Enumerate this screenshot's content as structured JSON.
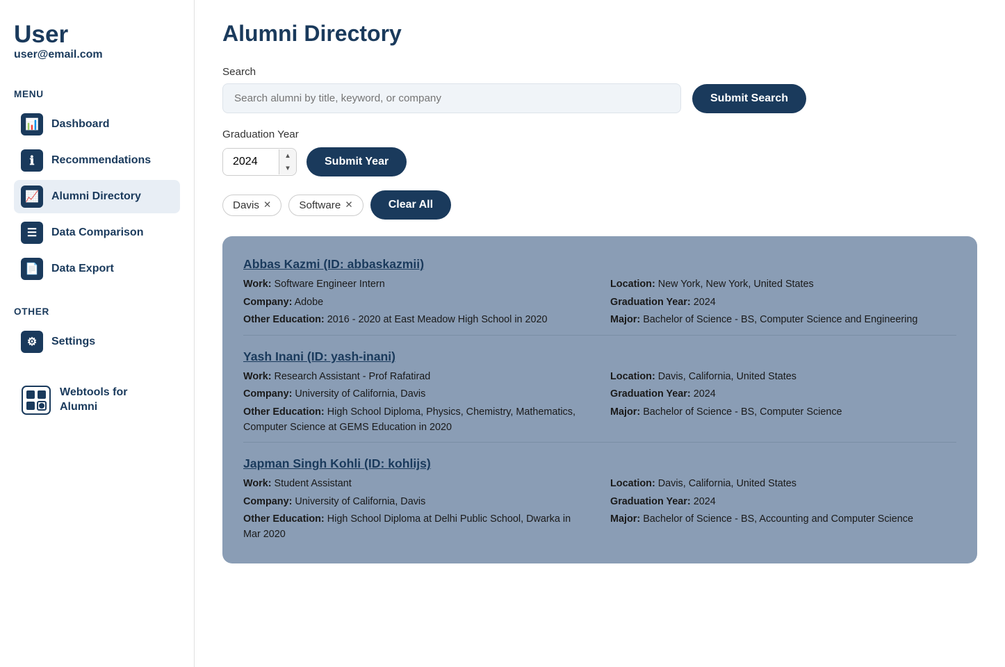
{
  "sidebar": {
    "user_name": "User",
    "user_email": "user@email.com",
    "menu_label": "MENU",
    "other_label": "OTHER",
    "menu_items": [
      {
        "id": "dashboard",
        "label": "Dashboard",
        "icon": "📊"
      },
      {
        "id": "recommendations",
        "label": "Recommendations",
        "icon": "ℹ"
      },
      {
        "id": "alumni-directory",
        "label": "Alumni Directory",
        "icon": "📈",
        "active": true
      },
      {
        "id": "data-comparison",
        "label": "Data Comparison",
        "icon": "☰"
      },
      {
        "id": "data-export",
        "label": "Data Export",
        "icon": "📄"
      }
    ],
    "other_items": [
      {
        "id": "settings",
        "label": "Settings",
        "icon": "⚙"
      }
    ],
    "webtools_label": "Webtools for\nAlumni"
  },
  "main": {
    "page_title": "Alumni Directory",
    "search": {
      "label": "Search",
      "placeholder": "Search alumni by title, keyword, or company",
      "submit_label": "Submit Search"
    },
    "grad_year": {
      "label": "Graduation Year",
      "value": "2024",
      "submit_label": "Submit Year"
    },
    "filters": [
      {
        "id": "davis",
        "label": "Davis"
      },
      {
        "id": "software",
        "label": "Software"
      }
    ],
    "clear_all_label": "Clear All",
    "alumni": [
      {
        "name": "Abbas Kazmi (ID: abbaskazmii)",
        "work": "Software Engineer Intern",
        "company": "Adobe",
        "other_education": "2016 - 2020 at East Meadow High School in 2020",
        "location": "New York, New York, United States",
        "graduation_year": "2024",
        "major": "Bachelor of Science - BS, Computer Science and Engineering"
      },
      {
        "name": "Yash Inani (ID: yash-inani)",
        "work": "Research Assistant - Prof Rafatirad",
        "company": "University of California, Davis",
        "other_education": "High School Diploma, Physics, Chemistry, Mathematics, Computer Science at GEMS Education in 2020",
        "location": "Davis, California, United States",
        "graduation_year": "2024",
        "major": "Bachelor of Science - BS, Computer Science"
      },
      {
        "name": "Japman Singh Kohli (ID: kohlijs)",
        "work": "Student Assistant",
        "company": "University of California, Davis",
        "other_education": "High School Diploma at Delhi Public School, Dwarka in Mar 2020",
        "location": "Davis, California, United States",
        "graduation_year": "2024",
        "major": "Bachelor of Science - BS, Accounting and Computer Science"
      }
    ]
  }
}
